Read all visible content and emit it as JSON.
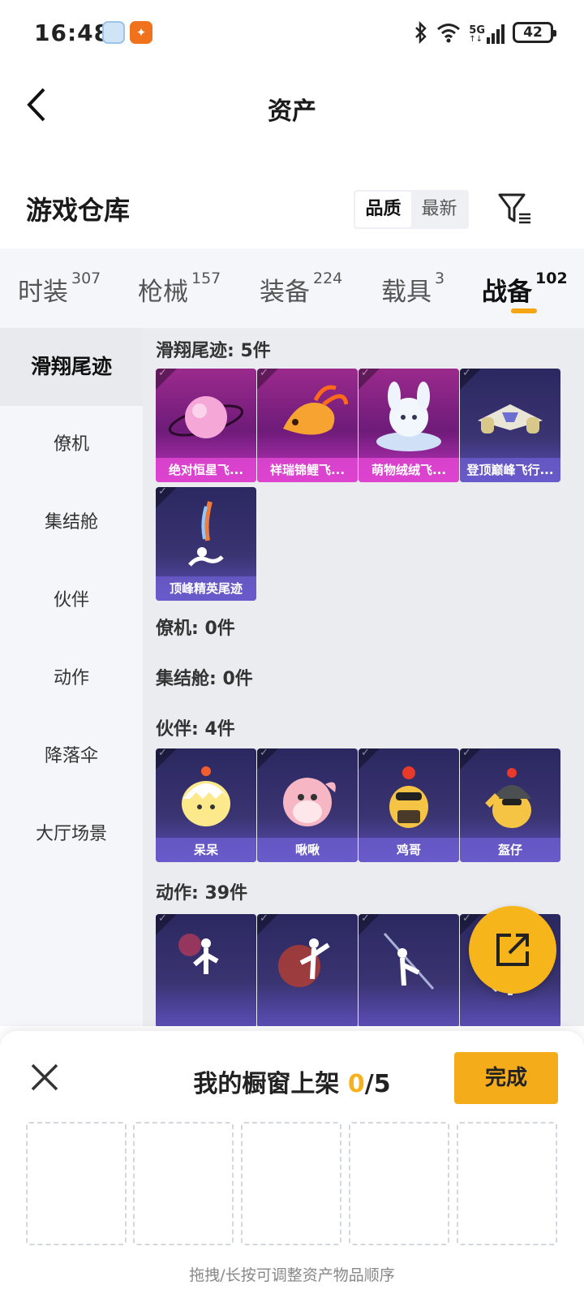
{
  "status": {
    "time": "16:48",
    "network": "5G",
    "battery": "42"
  },
  "nav": {
    "title": "资产"
  },
  "section": {
    "title": "游戏仓库",
    "sort": [
      "品质",
      "最新"
    ]
  },
  "tabs": [
    {
      "label": "时装",
      "count": "307"
    },
    {
      "label": "枪械",
      "count": "157"
    },
    {
      "label": "装备",
      "count": "224"
    },
    {
      "label": "载具",
      "count": "3"
    },
    {
      "label": "战备",
      "count": "102"
    }
  ],
  "sidebar": [
    "滑翔尾迹",
    "僚机",
    "集结舱",
    "伙伴",
    "动作",
    "降落伞",
    "大厅场景"
  ],
  "categories": {
    "glide": {
      "heading": "滑翔尾迹: 5件",
      "items": [
        "绝对恒星飞...",
        "祥瑞锦鲤飞...",
        "萌物绒绒飞...",
        "登顶巅峰飞行...",
        "顶峰精英尾迹"
      ]
    },
    "wingman": {
      "heading": "僚机: 0件"
    },
    "pod": {
      "heading": "集结舱: 0件"
    },
    "partner": {
      "heading": "伙伴: 4件",
      "items": [
        "呆呆",
        "啾啾",
        "鸡哥",
        "盔仔"
      ]
    },
    "emote": {
      "heading": "动作: 39件"
    }
  },
  "sheet": {
    "title_prefix": "我的橱窗上架 ",
    "count": "0",
    "total": "/5",
    "done": "完成",
    "hint": "拖拽/长按可调整资产物品顺序"
  },
  "colors": {
    "accent": "#f5ac1a",
    "rarity_pink": "#c235c0",
    "rarity_blue": "#5b4fb8"
  }
}
